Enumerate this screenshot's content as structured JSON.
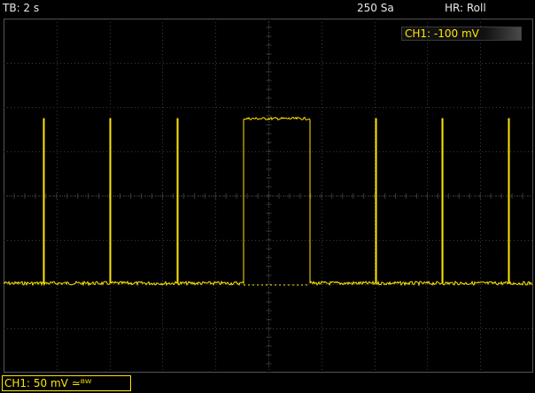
{
  "header": {
    "timebase": "TB: 2 s",
    "sample_rate": "250 Sa",
    "mode": "HR: Roll"
  },
  "channel": {
    "offset_label": "CH1: -100 mV",
    "scale_label": "CH1: 50 mV ≃ᴮᵂ"
  },
  "colors": {
    "trace": "#ffe600",
    "grid": "#3c3c3c",
    "background": "#000000"
  }
}
